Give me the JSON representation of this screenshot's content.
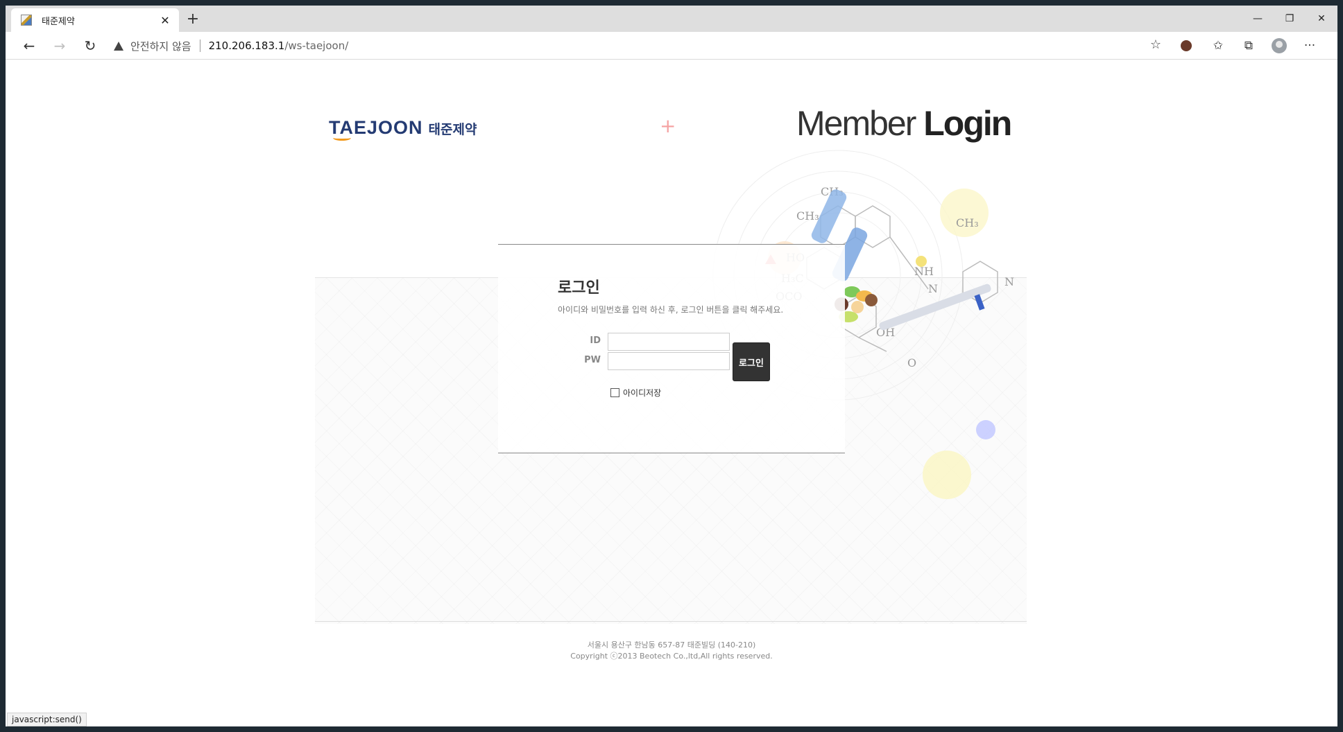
{
  "browser": {
    "tab_title": "태준제약",
    "address": {
      "security_warning": "안전하지 않음",
      "host": "210.206.183.1",
      "path": "/ws-taejoon/"
    },
    "status_text": "javascript:send()"
  },
  "header": {
    "logo_en": "TAEJOON",
    "logo_ko": "태준제약",
    "hero_light": "Member ",
    "hero_bold": "Login"
  },
  "login": {
    "title": "로그인",
    "description": "아이디와 비밀번호를 입력 하신 후, 로그인 버튼을 클릭 해주세요.",
    "id_label": "ID",
    "pw_label": "PW",
    "id_value": "",
    "pw_value": "",
    "submit_label": "로그인",
    "remember_label": "아이디저장",
    "remember_checked": false
  },
  "footer": {
    "address": "서울시 용산구 한남동 657-87 태준빌딩 (140-210)",
    "copyright": "Copyright ⓒ2013 Beotech Co.,ltd,All rights reserved."
  },
  "icons": [
    "back-icon",
    "forward-icon",
    "refresh-icon",
    "warning-icon",
    "star-icon",
    "extension-icon",
    "favorites-icon",
    "collections-icon",
    "profile-icon",
    "more-icon",
    "close-icon",
    "new-tab-icon",
    "minimize-icon",
    "restore-icon",
    "window-close-icon"
  ],
  "colors": {
    "brand_navy": "#243b73",
    "brand_orange": "#f29a1d",
    "button_dark": "#333333"
  }
}
